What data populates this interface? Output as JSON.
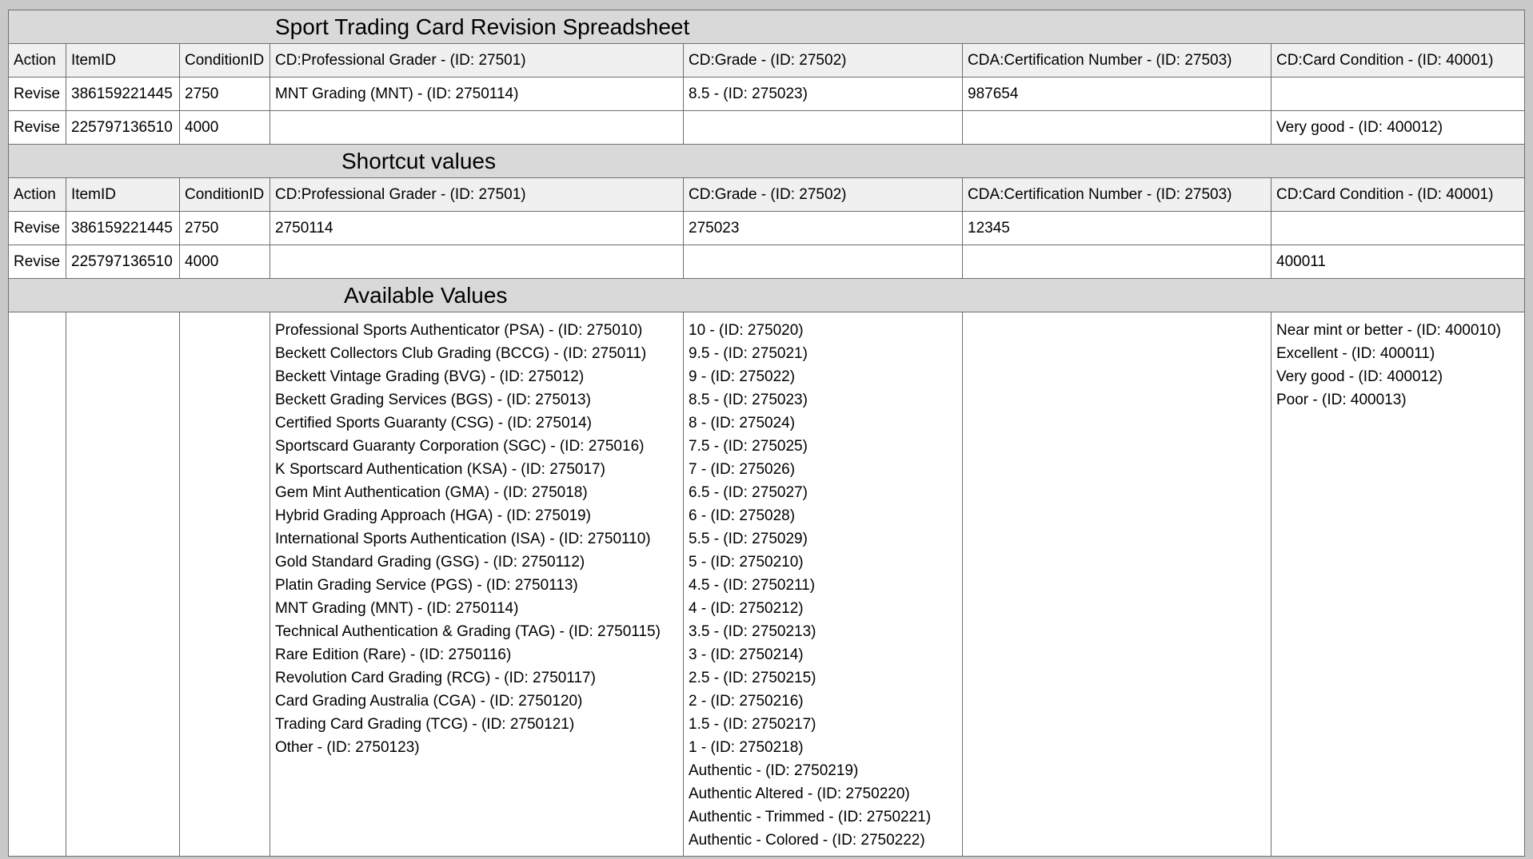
{
  "title": "Sport Trading Card Revision Spreadsheet",
  "headers": [
    "Action",
    "ItemID",
    "ConditionID",
    "CD:Professional Grader - (ID: 27501)",
    "CD:Grade - (ID: 27502)",
    "CDA:Certification Number - (ID: 27503)",
    "CD:Card Condition - (ID: 40001)"
  ],
  "main_rows": [
    [
      "Revise",
      "386159221445",
      "2750",
      "MNT Grading (MNT) - (ID: 2750114)",
      "8.5 - (ID: 275023)",
      "987654",
      ""
    ],
    [
      "Revise",
      "225797136510",
      "4000",
      "",
      "",
      "",
      "Very good - (ID: 400012)"
    ]
  ],
  "shortcut_title": "Shortcut values",
  "shortcut_rows": [
    [
      "Revise",
      "386159221445",
      "2750",
      "2750114",
      "275023",
      "12345",
      ""
    ],
    [
      "Revise",
      "225797136510",
      "4000",
      "",
      "",
      "",
      "400011"
    ]
  ],
  "available_title": "Available Values",
  "available": {
    "graders": [
      "Professional Sports Authenticator (PSA) - (ID: 275010)",
      "Beckett Collectors Club Grading (BCCG) - (ID: 275011)",
      "Beckett Vintage Grading (BVG) - (ID: 275012)",
      "Beckett Grading Services (BGS) - (ID: 275013)",
      "Certified Sports Guaranty (CSG) - (ID: 275014)",
      "Sportscard Guaranty Corporation (SGC) - (ID: 275016)",
      "K Sportscard Authentication (KSA) - (ID: 275017)",
      "Gem Mint Authentication (GMA) - (ID: 275018)",
      "Hybrid Grading Approach (HGA) - (ID: 275019)",
      "International Sports Authentication (ISA) - (ID: 2750110)",
      "Gold Standard Grading (GSG) - (ID: 2750112)",
      "Platin Grading Service (PGS) - (ID: 2750113)",
      "MNT Grading (MNT) - (ID: 2750114)",
      "Technical Authentication & Grading (TAG) - (ID: 2750115)",
      "Rare Edition (Rare) - (ID: 2750116)",
      "Revolution Card Grading (RCG) - (ID: 2750117)",
      "Card Grading Australia (CGA) - (ID: 2750120)",
      "Trading Card Grading (TCG) - (ID: 2750121)",
      "Other - (ID: 2750123)"
    ],
    "grades": [
      "10 - (ID: 275020)",
      "9.5 - (ID: 275021)",
      "9 - (ID: 275022)",
      "8.5 - (ID: 275023)",
      "8 - (ID: 275024)",
      "7.5 - (ID: 275025)",
      "7 - (ID: 275026)",
      "6.5 - (ID: 275027)",
      "6 - (ID: 275028)",
      "5.5 - (ID: 275029)",
      "5 - (ID: 2750210)",
      "4.5 - (ID: 2750211)",
      "4 - (ID: 2750212)",
      "3.5 - (ID: 2750213)",
      "3 - (ID: 2750214)",
      "2.5 - (ID: 2750215)",
      "2 - (ID: 2750216)",
      "1.5 - (ID: 2750217)",
      "1 - (ID: 2750218)",
      "Authentic - (ID: 2750219)",
      "Authentic Altered - (ID: 2750220)",
      "Authentic - Trimmed - (ID: 2750221)",
      "Authentic - Colored - (ID: 2750222)"
    ],
    "conditions": [
      "Near mint or better - (ID: 400010)",
      "Excellent - (ID: 400011)",
      "Very good - (ID: 400012)",
      "Poor - (ID: 400013)"
    ]
  }
}
